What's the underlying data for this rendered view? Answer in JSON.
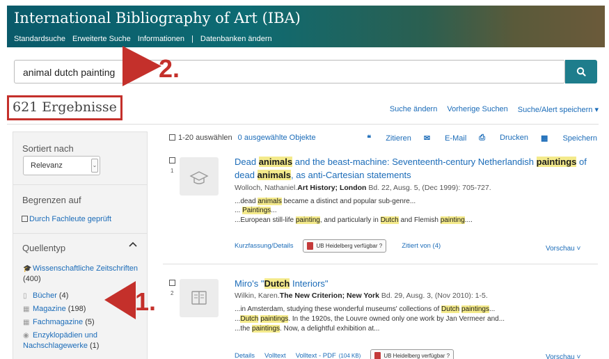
{
  "header": {
    "title": "International Bibliography of Art (IBA)",
    "nav": [
      "Standardsuche",
      "Erweiterte Suche",
      "Informationen",
      "|",
      "Datenbanken ändern"
    ]
  },
  "search": {
    "value": "animal dutch painting",
    "button_icon": "search-icon"
  },
  "results_count": "621 Ergebnisse",
  "top_links": [
    "Suche ändern",
    "Vorherige Suchen",
    "Suche/Alert speichern ▾"
  ],
  "sidebar": {
    "sort_label": "Sortiert nach",
    "sort_value": "Relevanz",
    "limit_label": "Begrenzen auf",
    "peer_reviewed": "Durch Fachleute geprüft",
    "source_type_label": "Quellentyp",
    "facets": [
      {
        "icon": "graduation-cap-icon",
        "label": "Wissenschaftliche Zeitschriften",
        "count": "(400)"
      },
      {
        "icon": "book-icon",
        "label": "Bücher",
        "count": "(4)"
      },
      {
        "icon": "magazine-icon",
        "label": "Magazine",
        "count": "(198)"
      },
      {
        "icon": "magazine-icon",
        "label": "Fachmagazine",
        "count": "(5)"
      },
      {
        "icon": "encyclopedia-icon",
        "label": "Enzyklopädien und Nachschlagewerke",
        "count": "(1)"
      }
    ]
  },
  "toolbar": {
    "select_all": "1-20 auswählen",
    "selected": "0 ausgewählte Objekte",
    "cite": "Zitieren",
    "email": "E-Mail",
    "print": "Drucken",
    "save": "Speichern"
  },
  "results": [
    {
      "num": "1",
      "meta_author": "Wolloch, Nathaniel.",
      "meta_source": "Art History; London",
      "meta_rest": " Bd. 22, Ausg. 5, (Dec 1999): 705-727.",
      "links": [
        "Kurzfassung/Details",
        "UB Heidelberg verfügbar ?",
        "Zitiert von (4)"
      ],
      "preview": "Vorschau ˅"
    },
    {
      "num": "2",
      "meta_author": "Wilkin, Karen.",
      "meta_source": "The New Criterion; New York",
      "meta_rest": " Bd. 29, Ausg. 3, (Nov 2010): 1-5.",
      "links": [
        "Details",
        "Volltext",
        "Volltext - PDF",
        "(104 KB)",
        "UB Heidelberg verfügbar ?"
      ],
      "preview": "Vorschau ˅"
    }
  ],
  "annotations": {
    "a1": "1.",
    "a2": "2."
  },
  "colors": {
    "accent": "#1e7d8c",
    "link": "#1a6bb8",
    "highlight": "#f4ea8b",
    "annotation": "#c4302b"
  }
}
